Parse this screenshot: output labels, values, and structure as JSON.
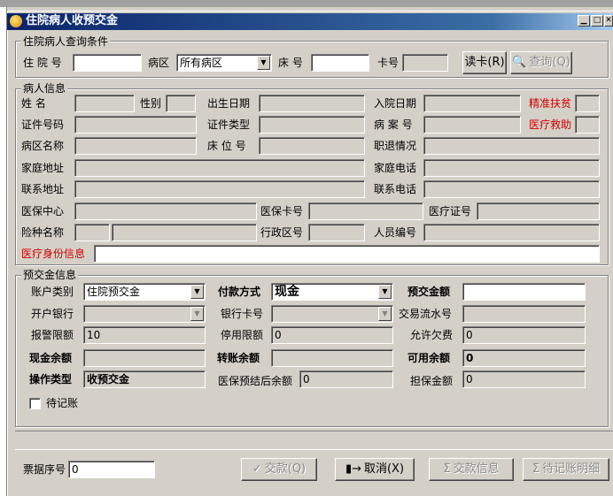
{
  "window": {
    "title": "住院病人收预交金"
  },
  "query": {
    "group_title": "住院病人查询条件",
    "inpatient_no_label": "住 院 号",
    "ward_label": "病区",
    "ward_value": "所有病区",
    "bed_label": "床  号",
    "card_label": "卡号",
    "read_card_button": "读卡(R)",
    "search_button": "查询(Q)"
  },
  "patient": {
    "group_title": "病人信息",
    "name_label": "姓      名",
    "gender_label": "性别",
    "birth_label": "出生日期",
    "admit_date_label": "入院日期",
    "poverty_label": "精准扶贫",
    "id_no_label": "证件号码",
    "id_type_label": "证件类型",
    "record_no_label": "病 案 号",
    "medical_aid_label": "医疗救助",
    "ward_name_label": "病区名称",
    "bed_no_label": "床 位 号",
    "retire_label": "职退情况",
    "home_addr_label": "家庭地址",
    "home_phone_label": "家庭电话",
    "contact_addr_label": "联系地址",
    "contact_phone_label": "联系电话",
    "ins_center_label": "医保中心",
    "ins_card_label": "医保卡号",
    "med_cert_label": "医疗证号",
    "ins_type_label": "险种名称",
    "admin_area_label": "行政区号",
    "staff_no_label": "人员编号",
    "med_identity_label": "医疗身份信息"
  },
  "deposit": {
    "group_title": "预交金信息",
    "account_type_label": "账户类别",
    "account_type_value": "住院预交金",
    "pay_method_label": "付款方式",
    "pay_method_value": "现金",
    "deposit_amount_label": "预交金额",
    "bank_label": "开户银行",
    "bank_card_label": "银行卡号",
    "txn_no_label": "交易流水号",
    "alarm_limit_label": "报警限额",
    "alarm_limit_value": "10",
    "stop_limit_label": "停用限额",
    "stop_limit_value": "0",
    "allow_debt_label": "允许欠费",
    "allow_debt_value": "0",
    "cash_balance_label": "现金余额",
    "transfer_balance_label": "转账余额",
    "available_balance_label": "可用余额",
    "available_balance_value": "0",
    "op_type_label": "操作类型",
    "op_type_value": "收预交金",
    "ins_settle_balance_label": "医保预结后余额",
    "ins_settle_balance_value": "0",
    "guarantee_label": "担保金额",
    "guarantee_value": "0",
    "pending_label": "待记账"
  },
  "footer": {
    "receipt_label": "票据序号",
    "receipt_value": "0",
    "pay_button": "交款(Q)",
    "cancel_button": "取消(X)",
    "pay_info_button": "交款信息",
    "pending_detail_button": "待记账明细"
  }
}
